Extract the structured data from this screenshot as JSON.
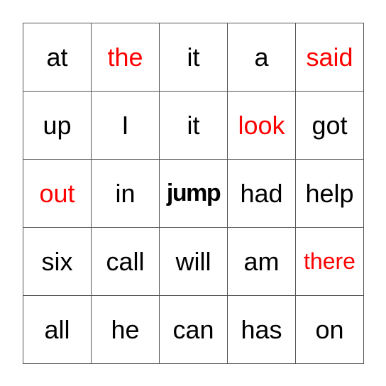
{
  "board": {
    "colors": {
      "highlight": "#ff0000",
      "normal": "#000000",
      "grid": "#555555"
    },
    "cells": [
      {
        "word": "at",
        "highlight": false
      },
      {
        "word": "the",
        "highlight": true
      },
      {
        "word": "it",
        "highlight": false
      },
      {
        "word": "a",
        "highlight": false
      },
      {
        "word": "said",
        "highlight": true
      },
      {
        "word": "up",
        "highlight": false
      },
      {
        "word": "I",
        "highlight": false
      },
      {
        "word": "it",
        "highlight": false
      },
      {
        "word": "look",
        "highlight": true
      },
      {
        "word": "got",
        "highlight": false
      },
      {
        "word": "out",
        "highlight": true
      },
      {
        "word": "in",
        "highlight": false
      },
      {
        "word": "jump",
        "highlight": false,
        "bold": true
      },
      {
        "word": "had",
        "highlight": false
      },
      {
        "word": "help",
        "highlight": false
      },
      {
        "word": "six",
        "highlight": false
      },
      {
        "word": "call",
        "highlight": false
      },
      {
        "word": "will",
        "highlight": false
      },
      {
        "word": "am",
        "highlight": false
      },
      {
        "word": "there",
        "highlight": true
      },
      {
        "word": "all",
        "highlight": false
      },
      {
        "word": "he",
        "highlight": false
      },
      {
        "word": "can",
        "highlight": false
      },
      {
        "word": "has",
        "highlight": false
      },
      {
        "word": "on",
        "highlight": false
      }
    ]
  }
}
